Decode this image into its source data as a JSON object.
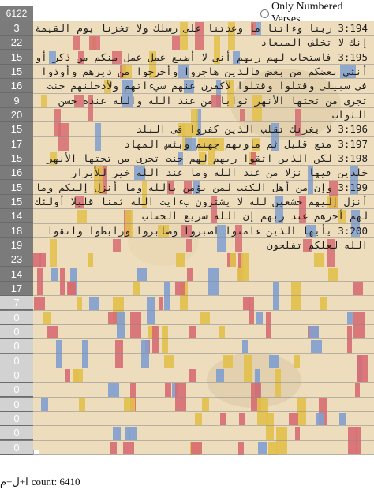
{
  "header": {
    "top_count": "6122",
    "toggle_label": "Only Numbered Verses"
  },
  "gutter": [
    "3",
    "22",
    "15",
    "15",
    "16",
    "9",
    "20",
    "15",
    "17",
    "15",
    "16",
    "15",
    "15",
    "14",
    "18",
    "19",
    "23",
    "14",
    "17",
    "7",
    "0",
    "0",
    "0",
    "0",
    "0",
    "0",
    "0",
    "0",
    "0",
    "0"
  ],
  "verses": [
    "3:194 ربنا وءاتنا ما وعدتنا على رسلك ولا تخزنا يوم القيمة",
    "إنك لا تخلف الميعاد",
    "3:195 فاستجاب لهم ربهم أنى لا أضيع عمل عمل منكم من ذكر أو",
    "أنثى بعضكم من بعض فالذين هاجروا وأخرجوا من ديرهم وأوذوا",
    "فى سبيلى وقتلوا وقتلوا لأكفرن عنهم سيءاتهم ولأدخلنهم جنت",
    "تجرى من تحتها الأنهر ثوابا من عند الله والله عنده حسن",
    "الثواب",
    "3:196 لا يغرنك تقلب الذين كفروا فى البلد",
    "3:197 متع قليل ثم ماوىهم جهنم وبئس المهاد",
    "3:198 لكن الذين اتقوا ربهم لهم جنت تجرى من تحتها الأنهر",
    "خلدين فيها نزلا من عند الله وما عند الله خير للأبرار",
    "3:199 وإن من أهل الكتب لمن يؤمن بالله وما أنزل إليكم وما",
    "أنزل إليهم خشعين لله لا يشترون بءايت الله ثمنا قليلا أولئك",
    "لهم أجرهم عند ربهم إن الله سريع الحساب",
    "3:200 يأيها الذين ءامنوا اصبروا وصابروا ورابطوا واتقوا",
    "الله لعلكم تفلحون"
  ],
  "footer": {
    "arabic_label": "ا+ل+م",
    "count_text": "count: 6410"
  },
  "colors": {
    "gutter_dark": "#7b7b7b",
    "gutter_light": "#d2d2d2",
    "paper": "#eeddbd",
    "bar_red": "#d76b72",
    "bar_blue": "#7f9fcf",
    "bar_yellow": "#e2c04a"
  }
}
